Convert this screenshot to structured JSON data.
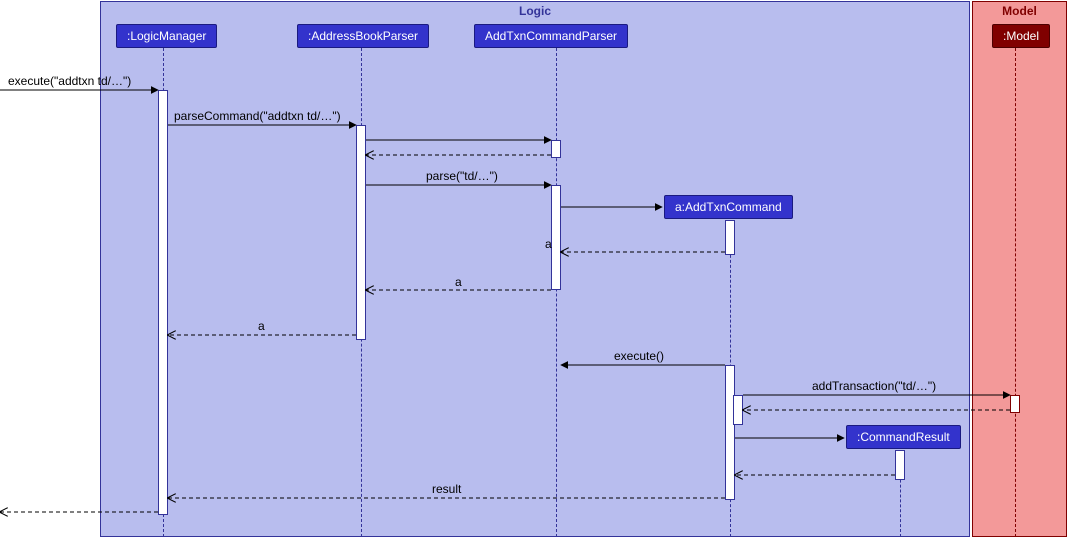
{
  "frames": {
    "logic": {
      "label": "Logic"
    },
    "model": {
      "label": "Model"
    }
  },
  "participants": {
    "logicManager": {
      "label": ":LogicManager"
    },
    "addrBookParser": {
      "label": ":AddressBookParser"
    },
    "addTxnParser": {
      "label": "AddTxnCommandParser"
    },
    "addTxnCmd": {
      "label": "a:AddTxnCommand"
    },
    "cmdResult": {
      "label": ":CommandResult"
    },
    "modelP": {
      "label": ":Model"
    }
  },
  "messages": {
    "execute_in": {
      "text": "execute(\"addtxn td/…\")"
    },
    "parseCommand": {
      "text": "parseCommand(\"addtxn td/…\")"
    },
    "parse": {
      "text": "parse(\"td/…\")"
    },
    "ret_a_1": {
      "text": "a"
    },
    "ret_a_2": {
      "text": "a"
    },
    "ret_a_3": {
      "text": "a"
    },
    "execute_call": {
      "text": "execute()"
    },
    "addTransaction": {
      "text": "addTransaction(\"td/…\")"
    },
    "ret_result": {
      "text": "result"
    }
  }
}
